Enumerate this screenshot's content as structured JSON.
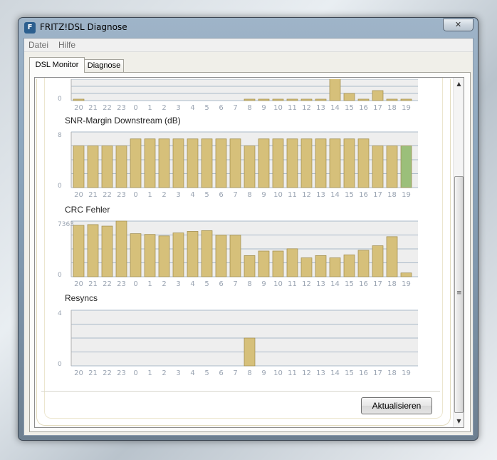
{
  "window": {
    "title": "FRITZ!DSL Diagnose",
    "close_glyph": "✕",
    "icon_glyph": "F"
  },
  "menu": {
    "items": [
      "Datei",
      "Hilfe"
    ]
  },
  "tabs": [
    {
      "label": "DSL Monitor",
      "active": true
    },
    {
      "label": "Diagnose",
      "active": false
    }
  ],
  "hours": [
    "20",
    "21",
    "22",
    "23",
    "0",
    "1",
    "2",
    "3",
    "4",
    "5",
    "6",
    "7",
    "8",
    "9",
    "10",
    "11",
    "12",
    "13",
    "14",
    "15",
    "16",
    "17",
    "18",
    "19"
  ],
  "charts": [
    {
      "title": "",
      "ymin_label": "0",
      "ymax_label": "",
      "max": 100,
      "values": [
        2,
        0,
        0,
        0,
        0,
        0,
        0,
        0,
        0,
        0,
        0,
        0,
        2,
        2,
        2,
        2,
        3,
        2,
        100,
        25,
        2,
        35,
        4,
        2
      ]
    },
    {
      "title": "SNR-Margin Downstream (dB)",
      "ymin_label": "0",
      "ymax_label": "8",
      "max": 8,
      "values": [
        6,
        6,
        6,
        6,
        7,
        7,
        7,
        7,
        7,
        7,
        7,
        7,
        6,
        7,
        7,
        7,
        7,
        7,
        7,
        7,
        7,
        6,
        6,
        6
      ]
    },
    {
      "title": "CRC Fehler",
      "ymin_label": "0",
      "ymax_label": "7363",
      "max": 7363,
      "values": [
        6800,
        6900,
        6700,
        7363,
        5700,
        5600,
        5400,
        5800,
        6000,
        6100,
        5500,
        5500,
        2800,
        3400,
        3400,
        3700,
        2500,
        2800,
        2500,
        2900,
        3500,
        4100,
        5300,
        500
      ]
    },
    {
      "title": "Resyncs",
      "ymin_label": "0",
      "ymax_label": "4",
      "max": 4,
      "values": [
        0,
        0,
        0,
        0,
        0,
        0,
        0,
        0,
        0,
        0,
        0,
        0,
        2,
        0,
        0,
        0,
        0,
        0,
        0,
        0,
        0,
        0,
        0,
        0
      ]
    }
  ],
  "colors": {
    "bar": "#d6c07a",
    "bar_highlight": "#9bbf7a",
    "grid": "#aab9c8",
    "plot_bg": "#eeeeee",
    "axis_text": "#9aa4b2"
  },
  "buttons": {
    "refresh": "Aktualisieren"
  },
  "scrollbar": {
    "up_glyph": "▲",
    "down_glyph": "▼",
    "grip_glyph": "≡"
  }
}
